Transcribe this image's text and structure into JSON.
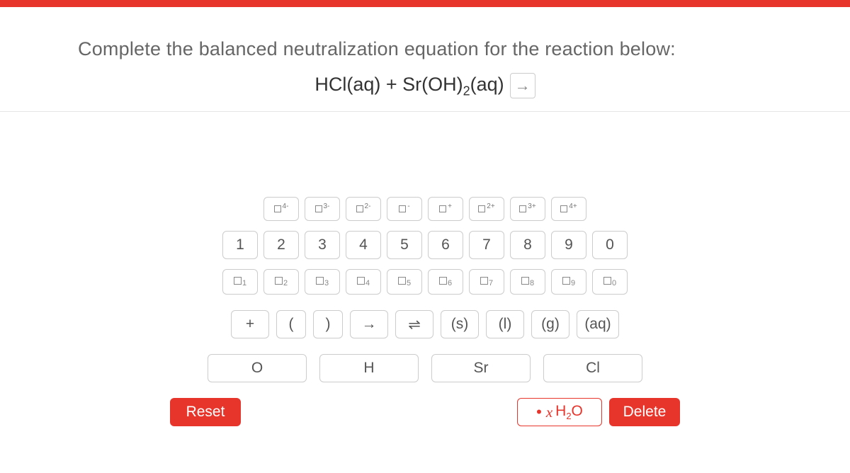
{
  "prompt": "Complete the balanced neutralization equation for the reaction below:",
  "equation": {
    "text": "HCl(aq) + Sr(OH)",
    "sub": "2",
    "tail": "(aq)",
    "arrow": "→"
  },
  "charges": [
    "4-",
    "3-",
    "2-",
    "-",
    "+",
    "2+",
    "3+",
    "4+"
  ],
  "numbers": [
    "1",
    "2",
    "3",
    "4",
    "5",
    "6",
    "7",
    "8",
    "9",
    "0"
  ],
  "subscripts": [
    "1",
    "2",
    "3",
    "4",
    "5",
    "6",
    "7",
    "8",
    "9",
    "0"
  ],
  "symbols": {
    "plus": "+",
    "lpar": "(",
    "rpar": ")",
    "rarr": "→",
    "equil": "⇌",
    "s": "(s)",
    "l": "(l)",
    "g": "(g)",
    "aq": "(aq)"
  },
  "elements": {
    "o": "O",
    "h": "H",
    "sr": "Sr",
    "cl": "Cl"
  },
  "controls": {
    "reset": "Reset",
    "h2o_x": "x",
    "h2o_label": "H₂O",
    "delete": "Delete"
  }
}
